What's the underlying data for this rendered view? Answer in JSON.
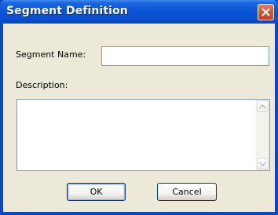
{
  "window": {
    "title": "Segment Definition"
  },
  "form": {
    "segment_name_label": "Segment Name:",
    "segment_name_value": "",
    "description_label": "Description:",
    "description_value": ""
  },
  "buttons": {
    "ok_label": "OK",
    "cancel_label": "Cancel"
  },
  "icons": {
    "close": "close-icon",
    "scroll_up": "scroll-up-arrow-icon",
    "scroll_down": "scroll-down-arrow-icon"
  },
  "colors": {
    "titlebar": "#0a55d8",
    "close_button": "#d5532f",
    "dialog_background": "#ece9d8",
    "input_border": "#7f9db9"
  }
}
